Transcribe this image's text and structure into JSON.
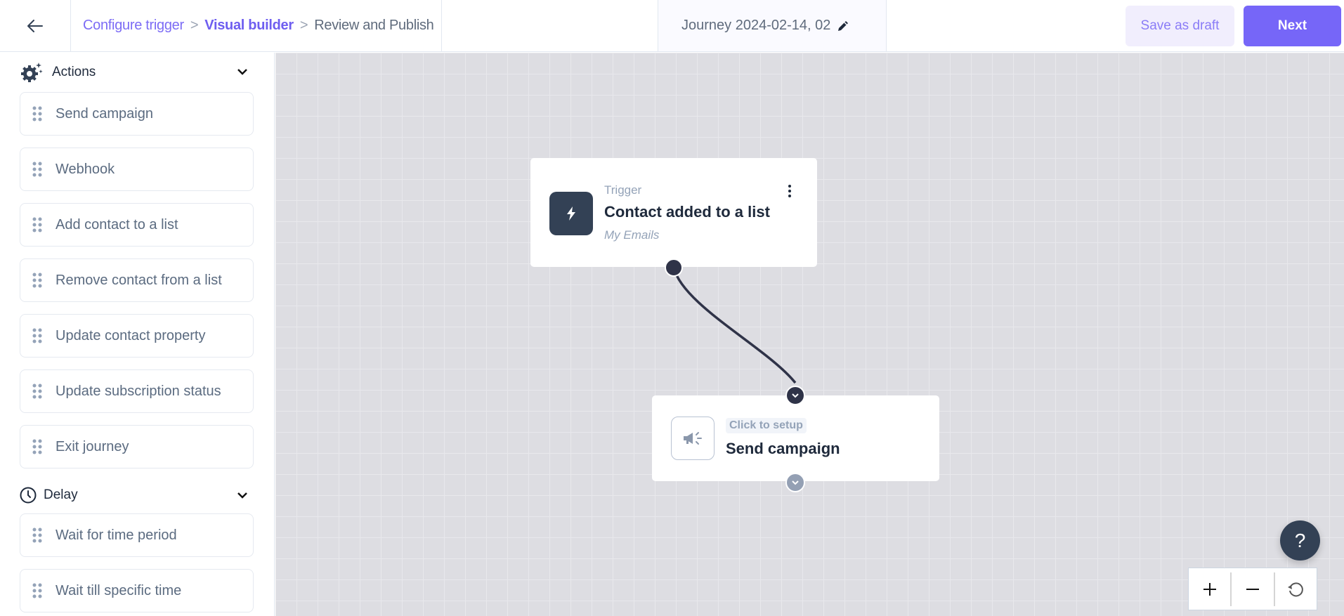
{
  "header": {
    "back_icon": "arrow-left-icon",
    "breadcrumbs": [
      {
        "label": "Configure trigger",
        "state": "done"
      },
      {
        "label": "Visual builder",
        "state": "active"
      },
      {
        "label": "Review and Publish",
        "state": "upcoming"
      }
    ],
    "separator": ">",
    "journey_title": "Journey 2024-02-14, 02",
    "edit_icon": "pencil-icon",
    "save_draft_label": "Save as draft",
    "next_label": "Next",
    "colors": {
      "accent": "#7666f8",
      "draft_bg": "#f1eefd"
    }
  },
  "sidebar": {
    "sections": [
      {
        "title": "Actions",
        "icon": "gear-sparkle-icon",
        "expanded": true,
        "items": [
          "Send campaign",
          "Webhook",
          "Add contact to a list",
          "Remove contact from a list",
          "Update contact property",
          "Update subscription status",
          "Exit journey"
        ]
      },
      {
        "title": "Delay",
        "icon": "clock-icon",
        "expanded": true,
        "items": [
          "Wait for time period",
          "Wait till specific time"
        ]
      }
    ]
  },
  "canvas": {
    "trigger_node": {
      "label": "Trigger",
      "title": "Contact added to a list",
      "subtitle": "My Emails",
      "icon": "lightning-icon"
    },
    "action_node": {
      "badge": "Click to setup",
      "title": "Send campaign",
      "icon": "megaphone-icon"
    },
    "help_label": "?",
    "zoom_controls": [
      "zoom-in",
      "zoom-out",
      "reset"
    ]
  }
}
